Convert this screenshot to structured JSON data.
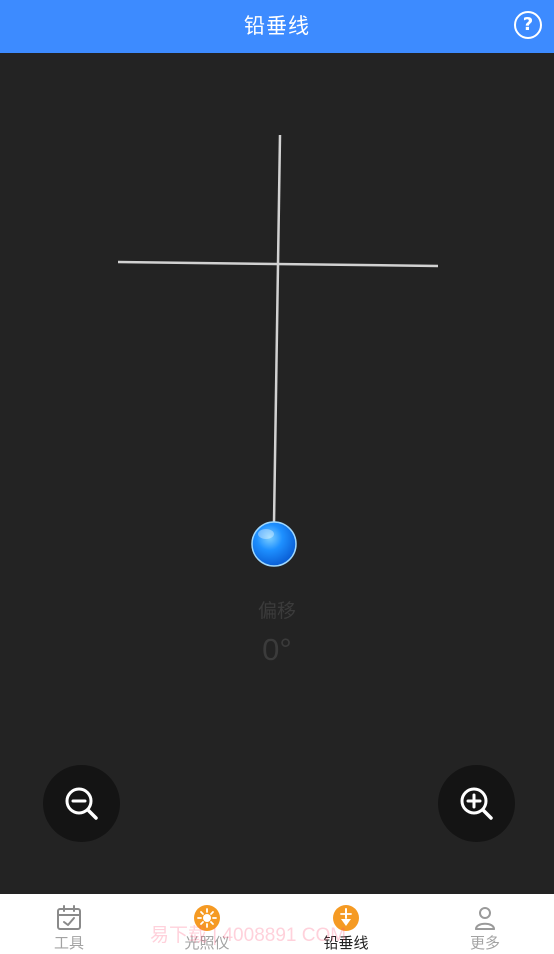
{
  "header": {
    "title": "铅垂线",
    "help_label": "?"
  },
  "readout": {
    "label": "偏移",
    "value": "0°"
  },
  "zoom": {
    "out_icon": "zoom-out-icon",
    "in_icon": "zoom-in-icon"
  },
  "tabs": [
    {
      "label": "工具",
      "icon": "calendar-check-icon",
      "active": false
    },
    {
      "label": "光照仪",
      "icon": "sun-icon",
      "active": false
    },
    {
      "label": "铅垂线",
      "icon": "plumb-icon",
      "active": true
    },
    {
      "label": "更多",
      "icon": "person-icon",
      "active": false
    }
  ],
  "watermark": "易下载 | 4008891 COM",
  "colors": {
    "header": "#3d8bff",
    "background": "#232323",
    "accent_orange": "#f59a23",
    "bob_blue": "#1e90ff"
  }
}
